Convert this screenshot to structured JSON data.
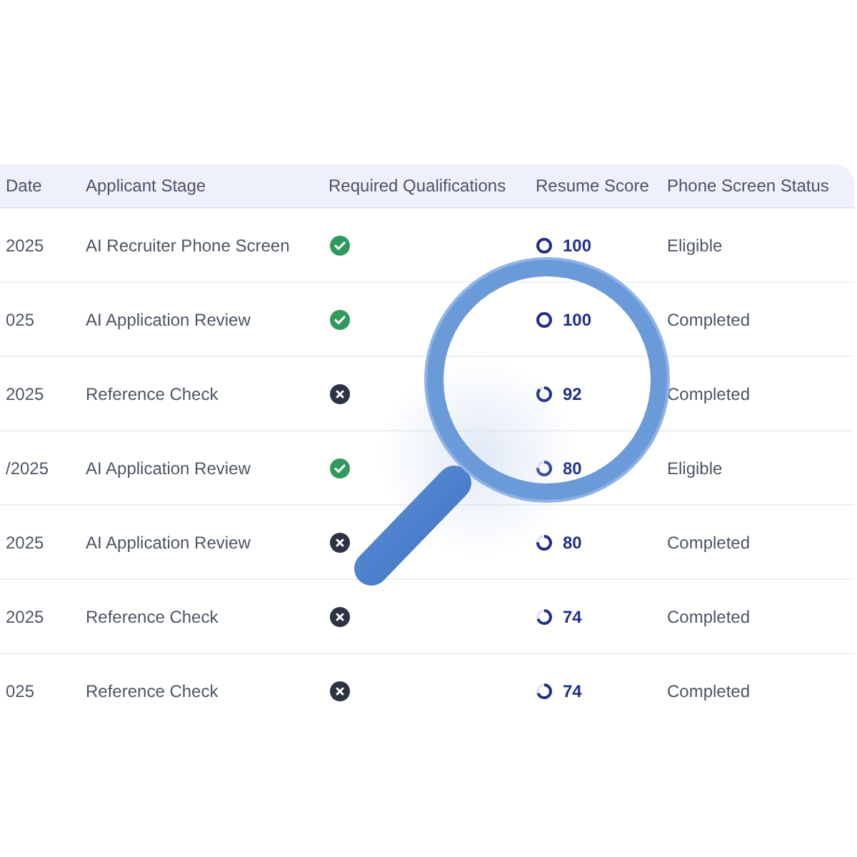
{
  "table": {
    "columns": [
      "Date",
      "Applicant Stage",
      "Required Qualifications",
      "Resume Score",
      "Phone Screen Status"
    ],
    "rows": [
      {
        "date": "2025",
        "stage": "AI Recruiter Phone Screen",
        "qualified": true,
        "score": "100",
        "level": 1,
        "status": "Eligible"
      },
      {
        "date": "025",
        "stage": "AI Application Review",
        "qualified": true,
        "score": "100",
        "level": 1,
        "status": "Completed"
      },
      {
        "date": "2025",
        "stage": "Reference Check",
        "qualified": false,
        "score": "92",
        "level": 0.92,
        "status": "Completed"
      },
      {
        "date": "/2025",
        "stage": "AI Application Review",
        "qualified": true,
        "score": "80",
        "level": 0.8,
        "status": "Eligible"
      },
      {
        "date": "2025",
        "stage": "AI Application Review",
        "qualified": false,
        "score": "80",
        "level": 0.8,
        "status": "Completed"
      },
      {
        "date": "2025",
        "stage": "Reference Check",
        "qualified": false,
        "score": "74",
        "level": 0.74,
        "status": "Completed"
      },
      {
        "date": "025",
        "stage": "Reference Check",
        "qualified": false,
        "score": "74",
        "level": 0.74,
        "status": "Completed"
      }
    ]
  }
}
